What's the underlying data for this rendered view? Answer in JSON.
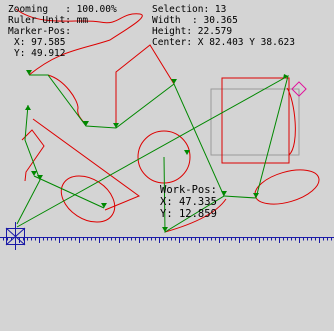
{
  "status": {
    "zooming": "Zooming   : 100.00%",
    "ruler_unit": "Ruler Unit: mm",
    "marker_pos": "Marker-Pos:",
    "marker_x": "X: 97.585",
    "marker_y": "Y: 49.912",
    "selection": "Selection: 13",
    "width": "Width  : 30.365",
    "height": "Height: 22.579",
    "center": "Center: X 82.403 Y 38.623"
  },
  "work_pos": {
    "label": "Work-Pos:",
    "x": "X: 47.335",
    "y": "Y: 12.859"
  },
  "colors": {
    "background": "#d4d4d4",
    "shape_red": "#dd0000",
    "path_green": "#008800",
    "ruler_blue": "#1a1aa6",
    "selection_gray": "#9a9a9a",
    "marker_magenta": "#e0109a"
  }
}
